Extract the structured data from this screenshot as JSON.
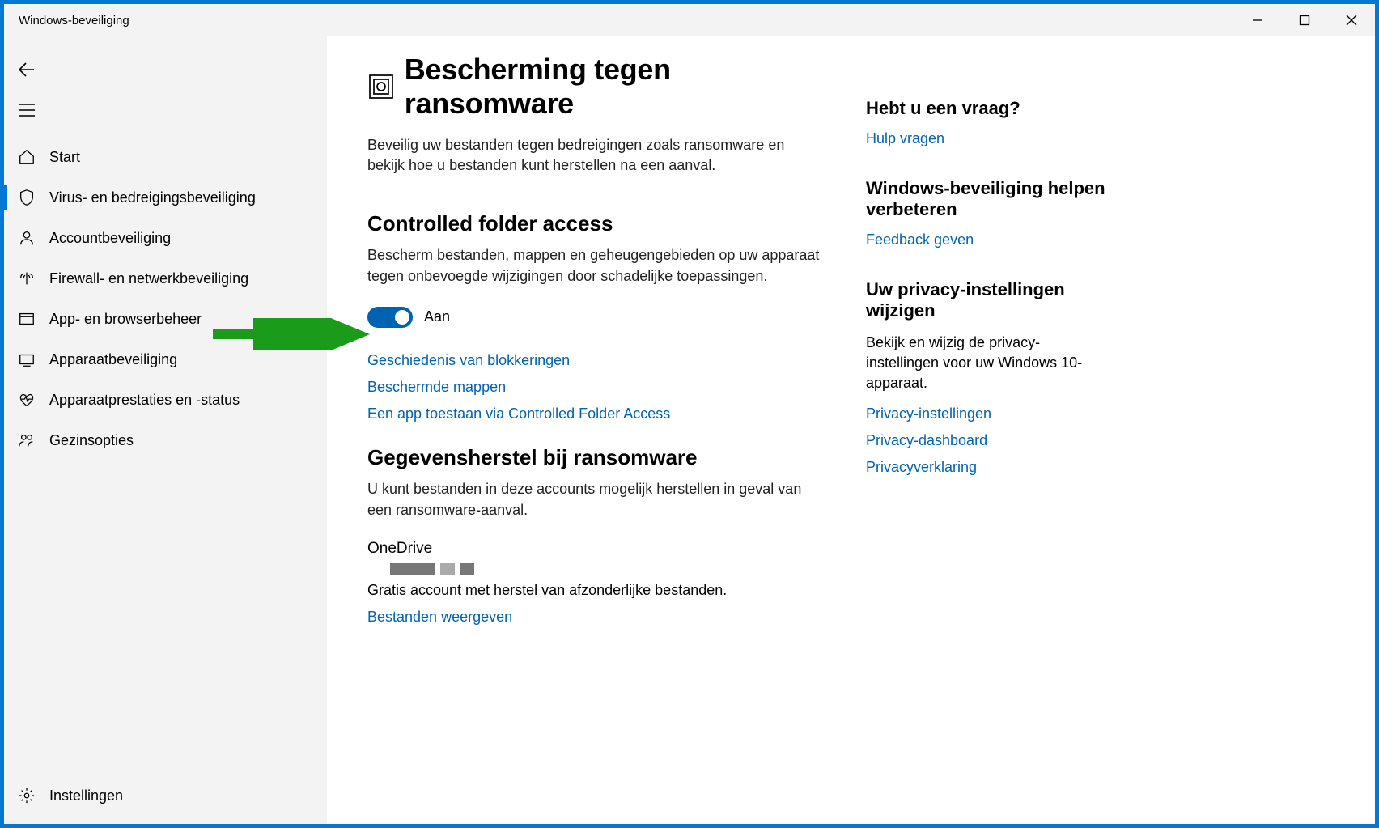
{
  "window": {
    "title": "Windows-beveiliging"
  },
  "sidebar": {
    "items": [
      {
        "label": "Start"
      },
      {
        "label": "Virus- en bedreigingsbeveiliging"
      },
      {
        "label": "Accountbeveiliging"
      },
      {
        "label": "Firewall- en netwerkbeveiliging"
      },
      {
        "label": "App- en browserbeheer"
      },
      {
        "label": "Apparaatbeveiliging"
      },
      {
        "label": "Apparaatprestaties en -status"
      },
      {
        "label": "Gezinsopties"
      }
    ],
    "settings": "Instellingen"
  },
  "main": {
    "title": "Bescherming tegen ransomware",
    "desc": "Beveilig uw bestanden tegen bedreigingen zoals ransomware en bekijk hoe u bestanden kunt herstellen na een aanval.",
    "cfa": {
      "title": "Controlled folder access",
      "desc": "Bescherm bestanden, mappen en geheugengebieden op uw apparaat tegen onbevoegde wijzigingen door schadelijke toepassingen.",
      "toggle_state": "Aan",
      "links": {
        "history": "Geschiedenis van blokkeringen",
        "protected": "Beschermde mappen",
        "allow": "Een app toestaan via Controlled Folder Access"
      }
    },
    "recovery": {
      "title": "Gegevensherstel bij ransomware",
      "desc": "U kunt bestanden in deze accounts mogelijk herstellen in geval van een ransomware-aanval.",
      "onedrive": "OneDrive",
      "free_account": "Gratis account met herstel van afzonderlijke bestanden.",
      "view_files": "Bestanden weergeven"
    }
  },
  "aside": {
    "question": {
      "title": "Hebt u een vraag?",
      "link": "Hulp vragen"
    },
    "improve": {
      "title": "Windows-beveiliging helpen verbeteren",
      "link": "Feedback geven"
    },
    "privacy": {
      "title": "Uw privacy-instellingen wijzigen",
      "desc": "Bekijk en wijzig de privacy-instellingen voor uw Windows 10-apparaat.",
      "links": {
        "settings": "Privacy-instellingen",
        "dashboard": "Privacy-dashboard",
        "statement": "Privacyverklaring"
      }
    }
  }
}
